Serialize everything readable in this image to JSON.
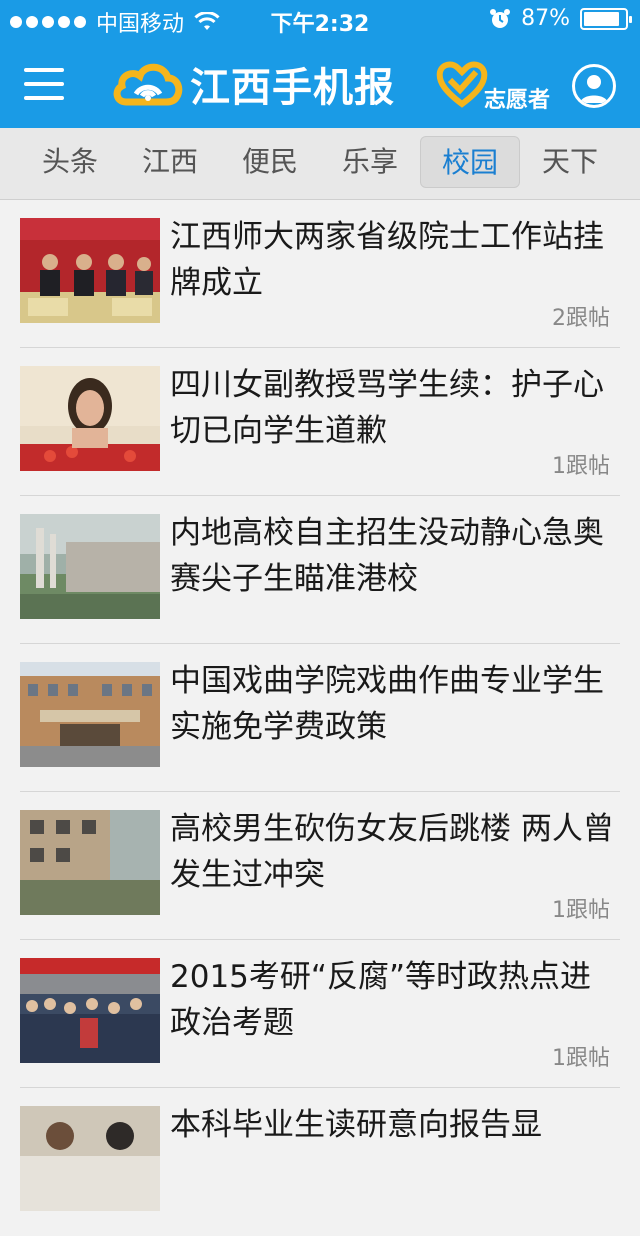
{
  "status": {
    "carrier": "中国移动",
    "time": "下午2:32",
    "battery": "87%",
    "battery_level": 0.87
  },
  "header": {
    "app_name": "江西手机报",
    "volunteer": "志愿者"
  },
  "tabs": [
    {
      "label": "头条"
    },
    {
      "label": "江西"
    },
    {
      "label": "便民"
    },
    {
      "label": "乐享"
    },
    {
      "label": "校园",
      "active": true
    },
    {
      "label": "天下"
    }
  ],
  "news": [
    {
      "title": "江西师大两家省级院士工作站挂牌成立",
      "comments": "2跟帖"
    },
    {
      "title": "四川女副教授骂学生续：护子心切已向学生道歉",
      "comments": "1跟帖"
    },
    {
      "title": "内地高校自主招生没动静心急奥赛尖子生瞄准港校",
      "comments": ""
    },
    {
      "title": "中国戏曲学院戏曲作曲专业学生实施免学费政策",
      "comments": ""
    },
    {
      "title": "高校男生砍伤女友后跳楼 两人曾发生过冲突",
      "comments": "1跟帖"
    },
    {
      "title": "2015考研“反腐”等时政热点进政治考题",
      "comments": "1跟帖"
    },
    {
      "title": "本科毕业生读研意向报告显",
      "comments": ""
    }
  ],
  "colors": {
    "header_bg": "#1a9be6",
    "active_tab": "#1a7fd1",
    "logo_yellow": "#f5b51c"
  }
}
